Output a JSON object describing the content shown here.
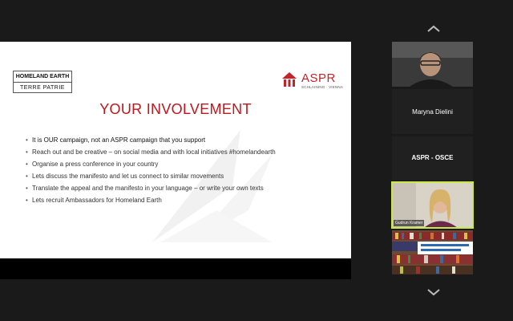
{
  "slide": {
    "logo_homeland_line1": "HOMELAND EARTH",
    "logo_homeland_line2": "TERRE PATRIE",
    "logo_aspr_name": "ASPR",
    "logo_aspr_sub": "SCHLAINING · VIENNA",
    "title": "YOUR INVOLVEMENT",
    "bullets": [
      "It is OUR campaign, not an ASPR campaign that you support",
      "Reach out and be creative – on social media and with local initiatives #homelandearth",
      "Organise a press conference in your country",
      "Lets discuss the manifesto and let us connect to similar movements",
      "Translate the appeal and the manifesto in your language – or write your own texts",
      "Lets recruit Ambassadors for Homeland Earth"
    ]
  },
  "participants": [
    {
      "name": "",
      "type": "video"
    },
    {
      "name": "Maryna Dielini",
      "type": "name-only"
    },
    {
      "name": "ASPR - OSCE",
      "type": "name-only"
    },
    {
      "name": "Gudrun Kramer",
      "type": "video",
      "active_speaker": true
    },
    {
      "name": "",
      "type": "video"
    }
  ],
  "colors": {
    "accent_red": "#c0161c",
    "active_outline": "#c8e84c"
  },
  "icons": [
    "chevron-up-icon",
    "chevron-down-icon"
  ]
}
